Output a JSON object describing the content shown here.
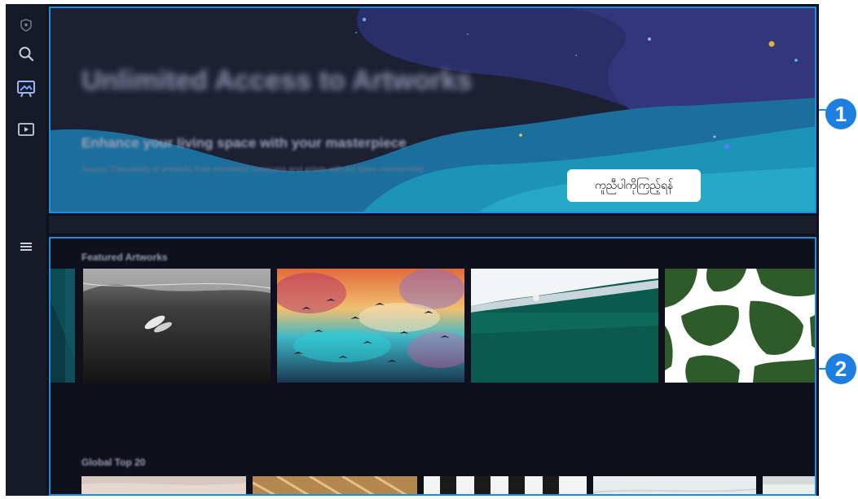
{
  "sidebar": {
    "icons": [
      "shield-icon",
      "search-icon",
      "art-store-icon",
      "media-icon",
      "menu-icon"
    ]
  },
  "hero": {
    "title": "Unlimited Access to Artworks",
    "subtitle": "Enhance your living space with your masterpiece",
    "description": "Access Thousands of artworks from renowned museums and artists with Art Store membership",
    "button_label": "ကူညီပါကိုကြည့်ရန်"
  },
  "sections": {
    "featured_title": "Featured Artworks",
    "global_title": "Global Top 20"
  },
  "callouts": {
    "one": "1",
    "two": "2"
  },
  "colors": {
    "highlight": "#1a8fe0",
    "callout": "#1f7fe0",
    "background": "#0e111b"
  }
}
